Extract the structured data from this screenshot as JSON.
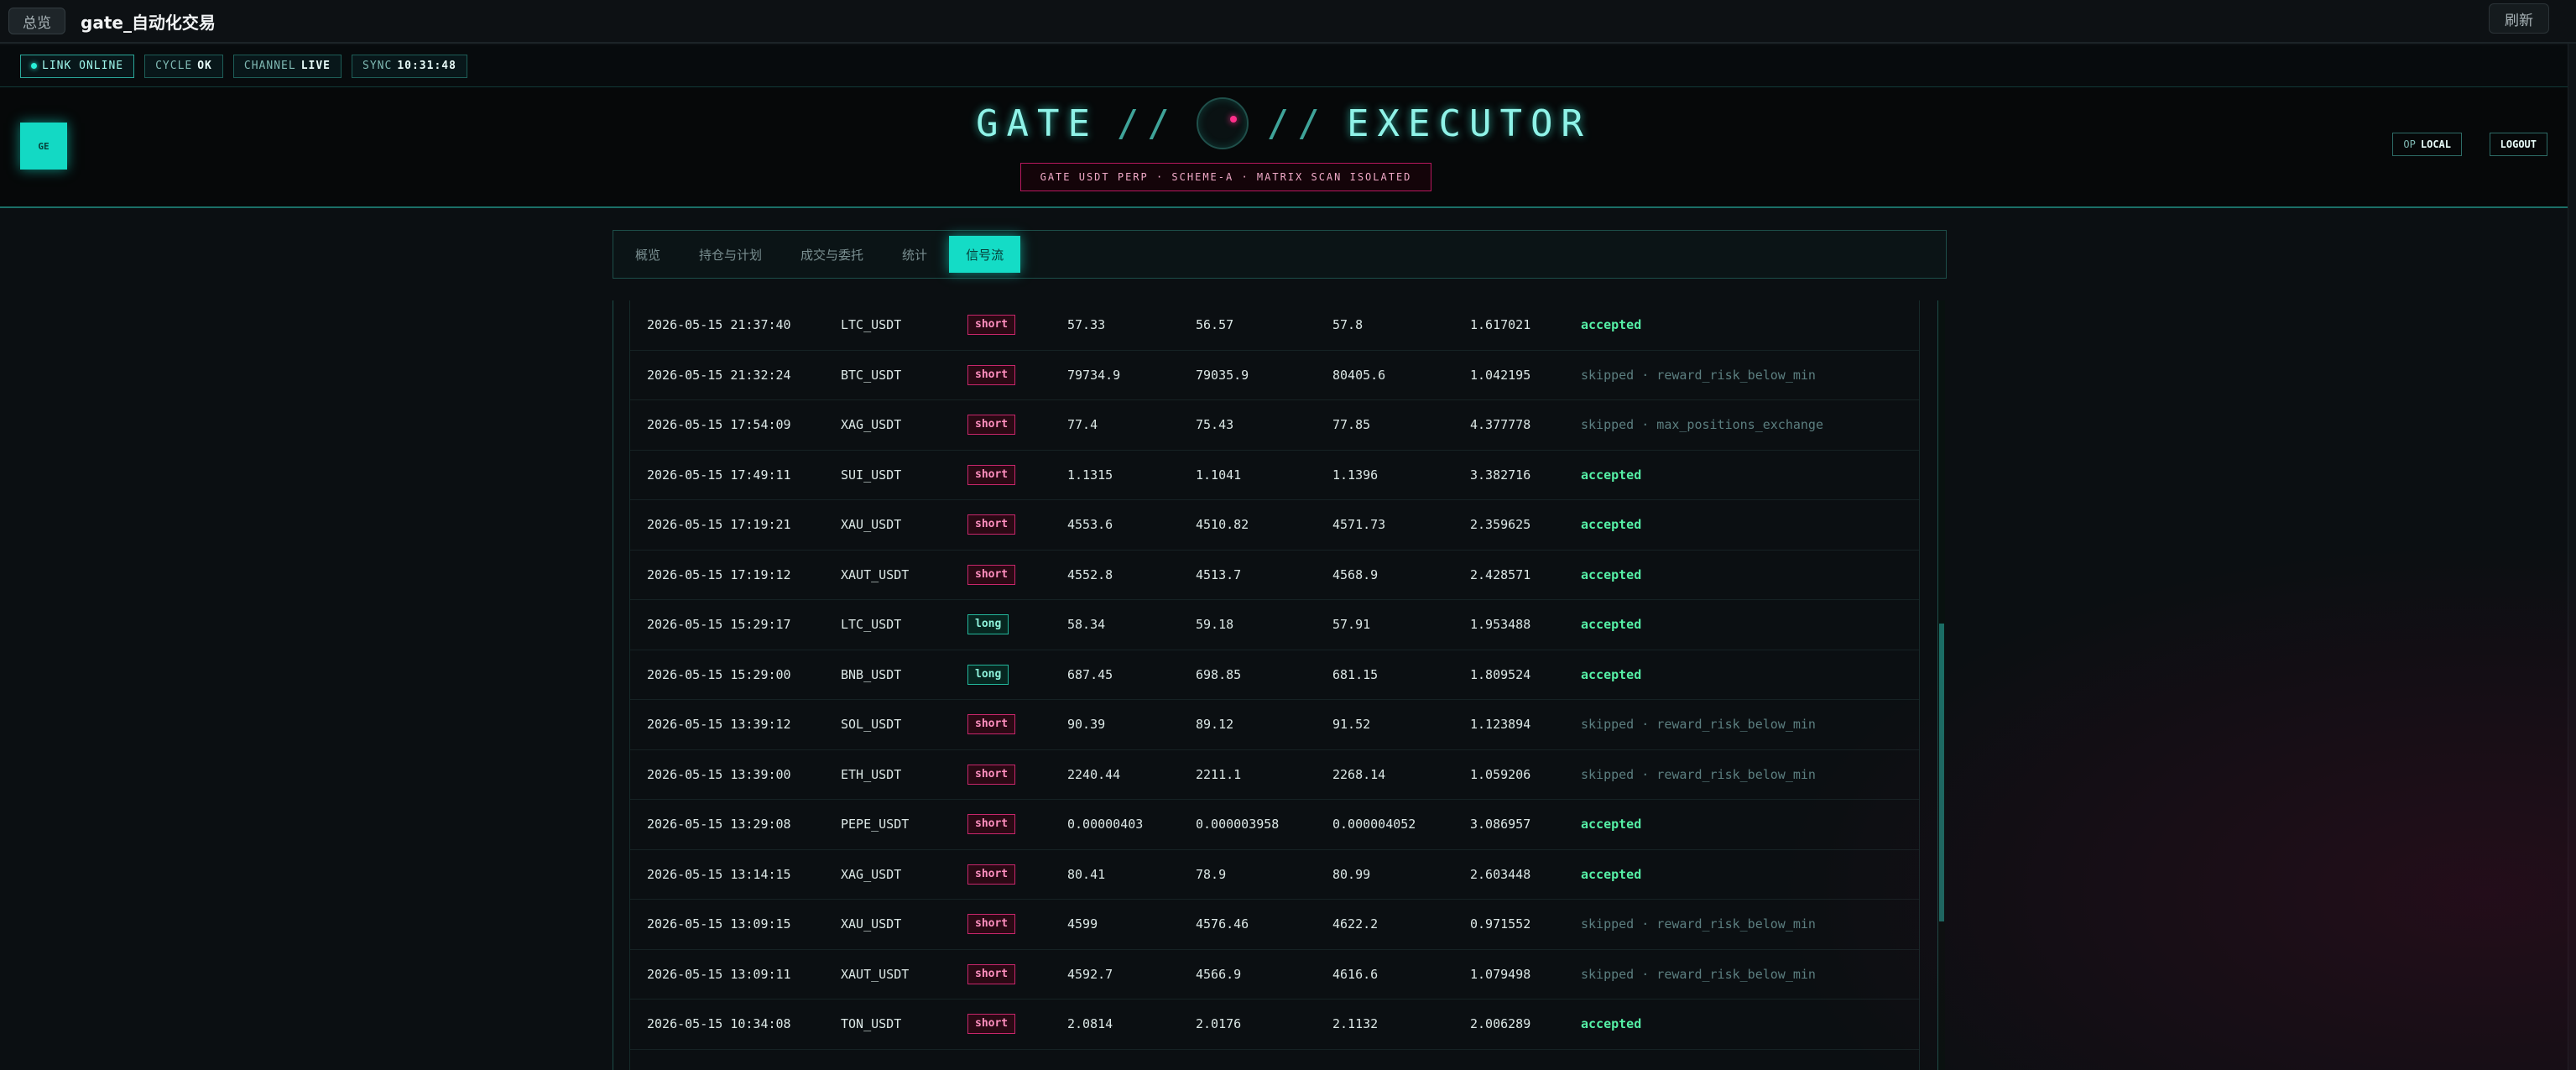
{
  "topbar": {
    "overview_label": "总览",
    "app_title": "gate_自动化交易",
    "refresh_label": "刷新"
  },
  "status": {
    "link_label": "LINK ONLINE",
    "cycle_label": "CYCLE",
    "cycle_value": "OK",
    "channel_label": "CHANNEL",
    "channel_value": "LIVE",
    "sync_label": "SYNC",
    "sync_value": "10:31:48"
  },
  "hero": {
    "logo_text": "GE",
    "brand_left": "GATE",
    "brand_sep": "//",
    "brand_right": "EXECUTOR",
    "subtitle": "GATE USDT PERP · SCHEME-A · MATRIX SCAN ISOLATED",
    "op_label": "OP",
    "op_value": "LOCAL",
    "logout_label": "LOGOUT"
  },
  "tabs": [
    {
      "label": "概览"
    },
    {
      "label": "持仓与计划"
    },
    {
      "label": "成交与委托"
    },
    {
      "label": "统计"
    },
    {
      "label": "信号流"
    }
  ],
  "rows": [
    {
      "time": "2026-05-15 21:37:40",
      "symbol": "LTC_USDT",
      "side": "short",
      "p1": "57.33",
      "p2": "56.57",
      "p3": "57.8",
      "rr": "1.617021",
      "status": "accepted"
    },
    {
      "time": "2026-05-15 21:32:24",
      "symbol": "BTC_USDT",
      "side": "short",
      "p1": "79734.9",
      "p2": "79035.9",
      "p3": "80405.6",
      "rr": "1.042195",
      "status": "skipped · reward_risk_below_min"
    },
    {
      "time": "2026-05-15 17:54:09",
      "symbol": "XAG_USDT",
      "side": "short",
      "p1": "77.4",
      "p2": "75.43",
      "p3": "77.85",
      "rr": "4.377778",
      "status": "skipped · max_positions_exchange"
    },
    {
      "time": "2026-05-15 17:49:11",
      "symbol": "SUI_USDT",
      "side": "short",
      "p1": "1.1315",
      "p2": "1.1041",
      "p3": "1.1396",
      "rr": "3.382716",
      "status": "accepted"
    },
    {
      "time": "2026-05-15 17:19:21",
      "symbol": "XAU_USDT",
      "side": "short",
      "p1": "4553.6",
      "p2": "4510.82",
      "p3": "4571.73",
      "rr": "2.359625",
      "status": "accepted"
    },
    {
      "time": "2026-05-15 17:19:12",
      "symbol": "XAUT_USDT",
      "side": "short",
      "p1": "4552.8",
      "p2": "4513.7",
      "p3": "4568.9",
      "rr": "2.428571",
      "status": "accepted"
    },
    {
      "time": "2026-05-15 15:29:17",
      "symbol": "LTC_USDT",
      "side": "long",
      "p1": "58.34",
      "p2": "59.18",
      "p3": "57.91",
      "rr": "1.953488",
      "status": "accepted"
    },
    {
      "time": "2026-05-15 15:29:00",
      "symbol": "BNB_USDT",
      "side": "long",
      "p1": "687.45",
      "p2": "698.85",
      "p3": "681.15",
      "rr": "1.809524",
      "status": "accepted"
    },
    {
      "time": "2026-05-15 13:39:12",
      "symbol": "SOL_USDT",
      "side": "short",
      "p1": "90.39",
      "p2": "89.12",
      "p3": "91.52",
      "rr": "1.123894",
      "status": "skipped · reward_risk_below_min"
    },
    {
      "time": "2026-05-15 13:39:00",
      "symbol": "ETH_USDT",
      "side": "short",
      "p1": "2240.44",
      "p2": "2211.1",
      "p3": "2268.14",
      "rr": "1.059206",
      "status": "skipped · reward_risk_below_min"
    },
    {
      "time": "2026-05-15 13:29:08",
      "symbol": "PEPE_USDT",
      "side": "short",
      "p1": "0.00000403",
      "p2": "0.000003958",
      "p3": "0.000004052",
      "rr": "3.086957",
      "status": "accepted"
    },
    {
      "time": "2026-05-15 13:14:15",
      "symbol": "XAG_USDT",
      "side": "short",
      "p1": "80.41",
      "p2": "78.9",
      "p3": "80.99",
      "rr": "2.603448",
      "status": "accepted"
    },
    {
      "time": "2026-05-15 13:09:15",
      "symbol": "XAU_USDT",
      "side": "short",
      "p1": "4599",
      "p2": "4576.46",
      "p3": "4622.2",
      "rr": "0.971552",
      "status": "skipped · reward_risk_below_min"
    },
    {
      "time": "2026-05-15 13:09:11",
      "symbol": "XAUT_USDT",
      "side": "short",
      "p1": "4592.7",
      "p2": "4566.9",
      "p3": "4616.6",
      "rr": "1.079498",
      "status": "skipped · reward_risk_below_min"
    },
    {
      "time": "2026-05-15 10:34:08",
      "symbol": "TON_USDT",
      "side": "short",
      "p1": "2.0814",
      "p2": "2.0176",
      "p3": "2.1132",
      "rr": "2.006289",
      "status": "accepted"
    }
  ]
}
